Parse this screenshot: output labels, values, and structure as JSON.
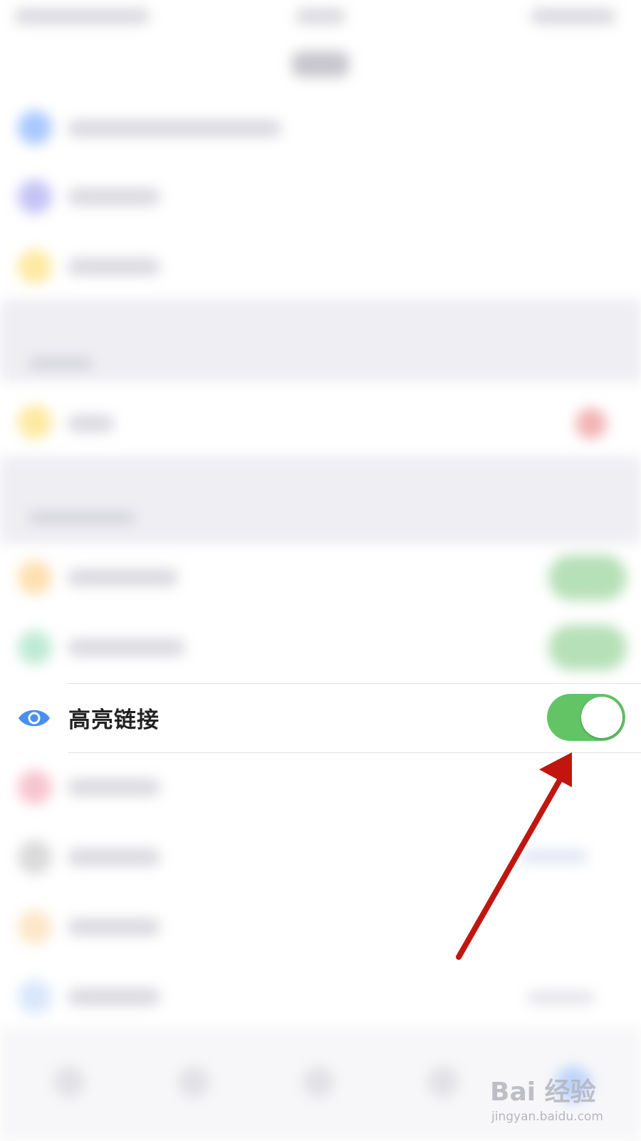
{
  "settings_row": {
    "label": "高亮链接",
    "icon": "eye-icon",
    "toggle_on": true
  },
  "colors": {
    "toggle_on": "#63c466",
    "eye_icon": "#4a8ff0",
    "arrow": "#c0160f"
  },
  "watermark": {
    "brand": "Bai 经验",
    "url": "jingyan.baidu.com"
  }
}
